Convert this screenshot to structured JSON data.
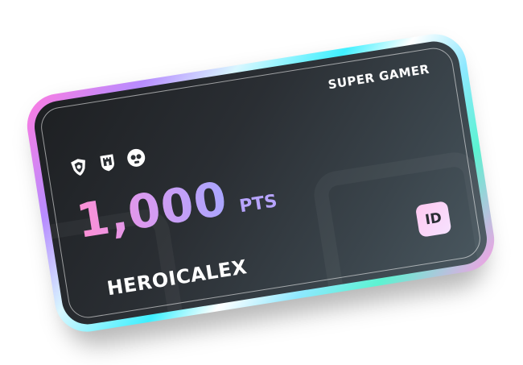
{
  "card": {
    "tier_label": "SUPER GAMER",
    "points_value": "1,000",
    "points_unit": "PTS",
    "username": "HEROICALEX",
    "id_label": "ID",
    "badges": [
      "shield-crest-icon",
      "castle-shield-icon",
      "skull-icon"
    ],
    "colors": {
      "card_background": "#2a2e33",
      "points_gradient_start": "#ff8fd4",
      "points_gradient_end": "#a9a6ff",
      "id_badge": "#ffc9f1",
      "holo_border": "#3ff0ff"
    }
  }
}
